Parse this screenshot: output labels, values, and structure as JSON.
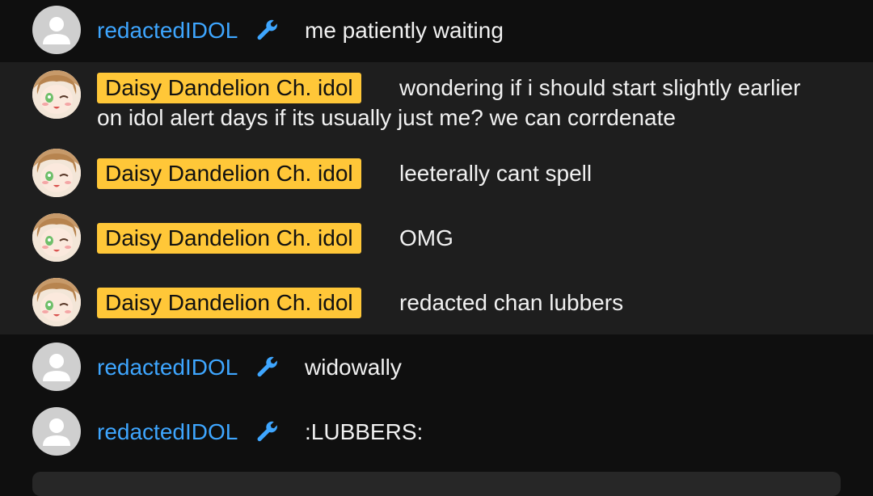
{
  "messages": [
    {
      "author": "redactedIDOL",
      "text": "me patiently waiting"
    },
    {
      "author": "Daisy Dandelion Ch. idol",
      "text": "wondering if i should start slightly earlier on idol alert days if its usually just me? we can corrdenate"
    },
    {
      "author": "Daisy Dandelion Ch. idol",
      "text": "leeterally cant spell"
    },
    {
      "author": "Daisy Dandelion Ch. idol",
      "text": "OMG"
    },
    {
      "author": "Daisy Dandelion Ch. idol",
      "text": "redacted chan lubbers"
    },
    {
      "author": "redactedIDOL",
      "text": "widowally"
    },
    {
      "author": "redactedIDOL",
      "text": ":LUBBERS:"
    }
  ],
  "icons": {
    "moderator": "wrench-icon",
    "default_avatar": "person-icon"
  },
  "colors": {
    "background": "#0f0f0f",
    "owner_row": "#1e1e1e",
    "moderator_name": "#3ea6ff",
    "owner_badge": "#ffc738",
    "text": "#f1f1f1"
  }
}
